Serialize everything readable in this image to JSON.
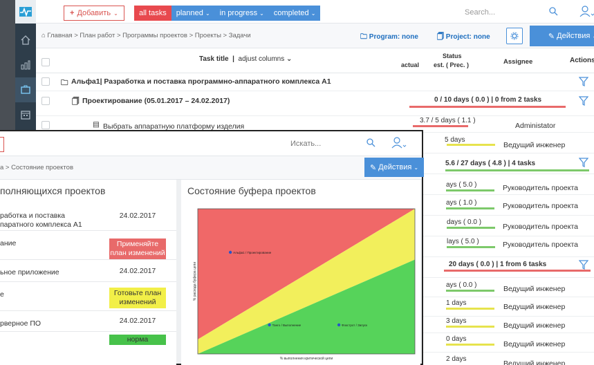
{
  "back_window": {
    "toolbar": {
      "add_label": "Добавить",
      "filters": [
        "all tasks",
        "planned",
        "in progress",
        "completed"
      ],
      "search_placeholder": "Search..."
    },
    "breadcrumb": "Главная > План работ > Программы проектов > Проекты > Задачи",
    "program_label": "Program: none",
    "project_label": "Project: none",
    "actions_label": "Действия",
    "table_header": {
      "task_title": "Task title",
      "adjust_columns": "adjust columns",
      "status": "Status",
      "actual": "actual",
      "est": "est. ( Prec. )",
      "assignee": "Assignee",
      "actions": "Actions"
    },
    "rows": [
      {
        "title": "Альфа1| Разработка и поставка программно-аппаратного комплекса А1",
        "status": "",
        "assignee": ""
      },
      {
        "title": "Проектирование (05.01.2017 – 24.02.2017)",
        "status": "0 / 10 days ( 0.0 ) | 0 from 2 tasks",
        "assignee": ""
      },
      {
        "title": "Выбрать аппаратную платформу изделия",
        "status": "3.7 / 5 days ( 1.1 )",
        "assignee": "Administator"
      },
      {
        "title": "",
        "status": "5 days",
        "assignee": "Ведущий инженер"
      },
      {
        "title": "",
        "status": "5.6 / 27 days ( 4.8 ) | 4 tasks",
        "assignee": ""
      },
      {
        "title": "",
        "status": "ays ( 5.0 )",
        "assignee": "Руководитель проекта"
      },
      {
        "title": "",
        "status": "ays ( 1.0 )",
        "assignee": "Руководитель проекта"
      },
      {
        "title": "",
        "status": "days ( 0.0 )",
        "assignee": "Руководитель проекта"
      },
      {
        "title": "",
        "status": "lays ( 5.0 )",
        "assignee": "Руководитель проекта"
      },
      {
        "title": "",
        "status": "20 days ( 0.0 ) | 1 from 6 tasks",
        "assignee": ""
      },
      {
        "title": "",
        "status": "ays ( 0.0 )",
        "assignee": "Ведущий инженер"
      },
      {
        "title": "",
        "status": "1 days",
        "assignee": "Ведущий инженер"
      },
      {
        "title": "",
        "status": "3 days",
        "assignee": "Ведущий инженер"
      },
      {
        "title": "",
        "status": "0 days",
        "assignee": "Ведущий инженер"
      },
      {
        "title": "",
        "status": "2 days",
        "assignee": "Ведущий инженер"
      }
    ]
  },
  "front_window": {
    "search_placeholder": "Искать...",
    "breadcrumb": "а > Состояние проектов",
    "actions_label": "Действия",
    "left_panel": {
      "title": "полняющихся проектов",
      "rows": [
        {
          "name": "работка и поставка\nпаратного комплекса А1",
          "value": "24.02.2017",
          "badge": ""
        },
        {
          "name": "ание",
          "value": "",
          "badge": "Применяйте план изменений",
          "badge_color": "#e86a6a"
        },
        {
          "name": "ьное приложение",
          "value": "24.02.2017",
          "badge": ""
        },
        {
          "name": "е",
          "value": "",
          "badge": "Готовьте план изменений",
          "badge_color": "#f2ef48"
        },
        {
          "name": "рверное ПО",
          "value": "24.02.2017",
          "badge": ""
        },
        {
          "name": "",
          "value": "",
          "badge": "норма",
          "badge_color": "#47c24a"
        }
      ]
    },
    "right_panel": {
      "title": "Состояние буфера проектов",
      "chart_data": {
        "type": "scatter",
        "title": "",
        "xlabel": "% выполнения критической цепи",
        "ylabel": "% расхода буфера цепи",
        "xlim": [
          0,
          100
        ],
        "ylim": [
          0,
          100
        ],
        "zones": [
          {
            "name": "red",
            "color": "#f06868"
          },
          {
            "name": "yellow",
            "color": "#f2ef5c"
          },
          {
            "name": "green",
            "color": "#56d35a"
          }
        ],
        "series": [
          {
            "name": "Альфа1 / Проектирование",
            "x": 15,
            "y": 70
          },
          {
            "name": "Танго / Выполнение",
            "x": 33,
            "y": 20
          },
          {
            "name": "Фокстрот / Запуск",
            "x": 65,
            "y": 20
          }
        ]
      }
    }
  }
}
